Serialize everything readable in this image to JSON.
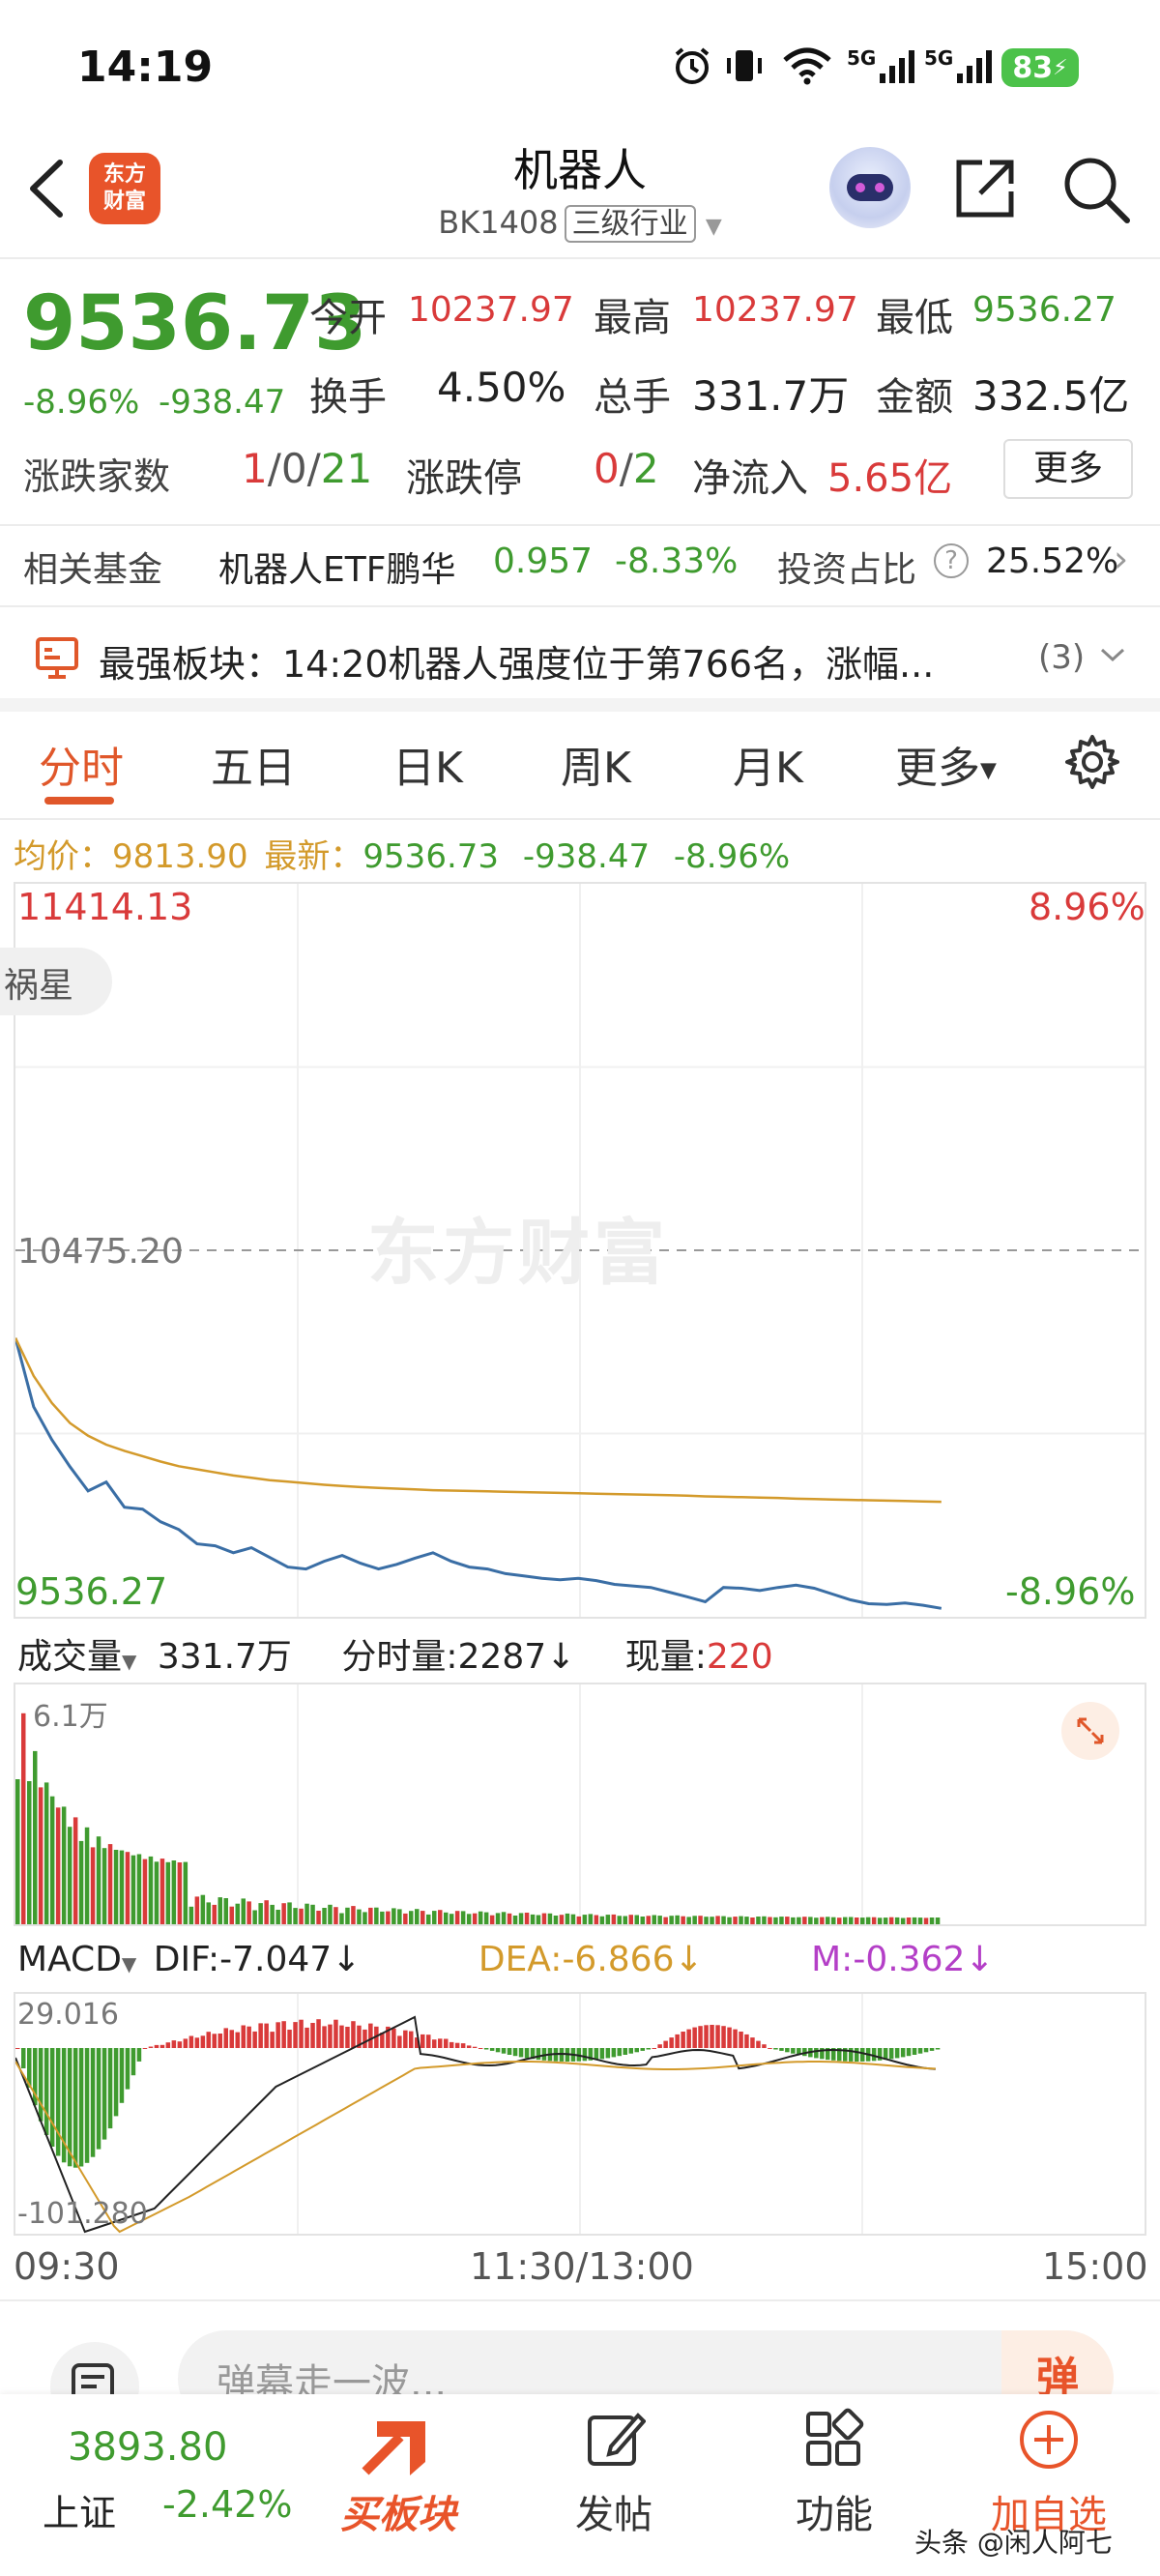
{
  "status_bar": {
    "time": "14:19",
    "network_1": "5G",
    "network_2": "5G",
    "battery": "83"
  },
  "header": {
    "logo_line1": "东方",
    "logo_line2": "财富",
    "title": "机器人",
    "code": "BK1408",
    "industry_tag": "三级行业"
  },
  "quote": {
    "price": "9536.73",
    "change_pct": "-8.96%",
    "change_abs": "-938.47",
    "open_label": "今开",
    "open_value": "10237.97",
    "high_label": "最高",
    "high_value": "10237.97",
    "low_label": "最低",
    "low_value": "9536.27",
    "turnover_label": "换手",
    "turnover_value": "4.50%",
    "volume_label": "总手",
    "volume_value": "331.7万",
    "amount_label": "金额",
    "amount_value": "332.5亿",
    "adv_label": "涨跌家数",
    "adv_up": "1",
    "adv_sep1": "/",
    "adv_flat": "0",
    "adv_sep2": "/",
    "adv_down": "21",
    "limit_label": "涨跌停",
    "limit_up": "0",
    "limit_sep": "/",
    "limit_down": "2",
    "netflow_label": "净流入",
    "netflow_value": "5.65亿",
    "more_button": "更多"
  },
  "fund": {
    "label": "相关基金",
    "name": "机器人ETF鹏华",
    "price": "0.957",
    "pct": "-8.33%",
    "ratio_label": "投资占比",
    "ratio_value": "25.52%"
  },
  "strong": {
    "text": "最强板块：14:20机器人强度位于第766名，涨幅...",
    "count": "(3)"
  },
  "tabs": [
    "分时",
    "五日",
    "日K",
    "周K",
    "月K",
    "更多"
  ],
  "intraday_info": {
    "avg_label": "均价：",
    "avg_value": "9813.90",
    "latest_label": "最新：",
    "latest_value": "9536.73",
    "latest_abs": "-938.47",
    "latest_pct": "-8.96%"
  },
  "colors": {
    "accent": "#e0572a",
    "up": "#d93a3a",
    "down": "#3f9b2f",
    "avg_line": "#d39a2b",
    "price_line": "#3a6ea5",
    "macd_pink": "#b43fc7"
  },
  "chart_data": {
    "type": "line",
    "price_axis": {
      "max_label": "11414.13",
      "mid_label": "10475.20",
      "min_label": "9536.27",
      "max_pct": "8.96%",
      "min_pct": "-8.96%",
      "ylim": [
        9536.27,
        11414.13
      ]
    },
    "tooltip_tag": "祸星",
    "watermark": "东方财富",
    "x_ticks": [
      "09:30",
      "11:30/13:00",
      "15:00"
    ],
    "series": [
      {
        "name": "最新",
        "values": [
          10237.97,
          10060,
          9975,
          9905,
          9842,
          9865,
          9800,
          9795,
          9762,
          9742,
          9705,
          9700,
          9682,
          9695,
          9670,
          9645,
          9640,
          9660,
          9675,
          9655,
          9640,
          9652,
          9668,
          9682,
          9660,
          9645,
          9640,
          9628,
          9622,
          9616,
          9612,
          9616,
          9610,
          9600,
          9596,
          9592,
          9580,
          9568,
          9555,
          9592,
          9590,
          9584,
          9592,
          9598,
          9590,
          9575,
          9560,
          9550,
          9548,
          9552,
          9546,
          9538
        ]
      },
      {
        "name": "均价",
        "values": [
          10237.97,
          10140,
          10070,
          10018,
          9985,
          9962,
          9946,
          9932,
          9918,
          9906,
          9898,
          9890,
          9882,
          9876,
          9870,
          9866,
          9862,
          9858,
          9855,
          9852,
          9850,
          9848,
          9846,
          9844,
          9843,
          9842,
          9841,
          9840,
          9839,
          9838,
          9837,
          9836,
          9835,
          9834,
          9833,
          9832,
          9831,
          9830,
          9828,
          9827,
          9826,
          9825,
          9824,
          9822,
          9821,
          9820,
          9819,
          9818,
          9817,
          9816,
          9815,
          9814
        ]
      }
    ],
    "volume": {
      "label": "成交量",
      "total": "331.7万",
      "tick_label": "分时量:",
      "tick_value": "2287",
      "current_label": "现量:",
      "current_value": "220",
      "max_label": "6.1万"
    },
    "macd": {
      "label": "MACD",
      "dif_label": "DIF:",
      "dif_value": "-7.047",
      "dea_label": "DEA:",
      "dea_value": "-6.866",
      "m_label": "M:",
      "m_value": "-0.362",
      "max_label": "29.016",
      "min_label": "-101.280"
    }
  },
  "danmu": {
    "placeholder": "弹幕走一波...",
    "button": "弹"
  },
  "bottom_nav": {
    "index_value": "3893.80",
    "index_name": "上证",
    "index_pct": "-2.42%",
    "buy": "买板块",
    "post": "发帖",
    "func": "功能",
    "add": "加自选",
    "source": "头条 @闲人阿七"
  }
}
